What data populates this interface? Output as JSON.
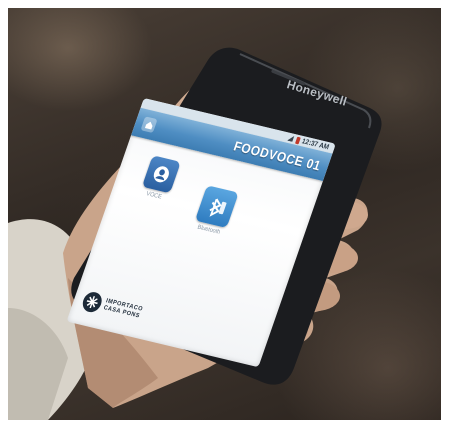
{
  "phone": {
    "brand": "Honeywell",
    "status_time": "12:37 AM"
  },
  "app": {
    "title": "FOODVOCE 01",
    "tiles": [
      {
        "label": "VOCE",
        "icon": "voice-icon"
      },
      {
        "label": "Bluetooth",
        "icon": "bluetooth-icon"
      }
    ],
    "logo_line1": "IMPORTACO",
    "logo_line2": "CASA PONS"
  },
  "colors": {
    "appbar": "#4f8ec3",
    "screen": "#f4f6f8",
    "tile_icon": "#2a5fa0",
    "background": "#2e2722"
  }
}
